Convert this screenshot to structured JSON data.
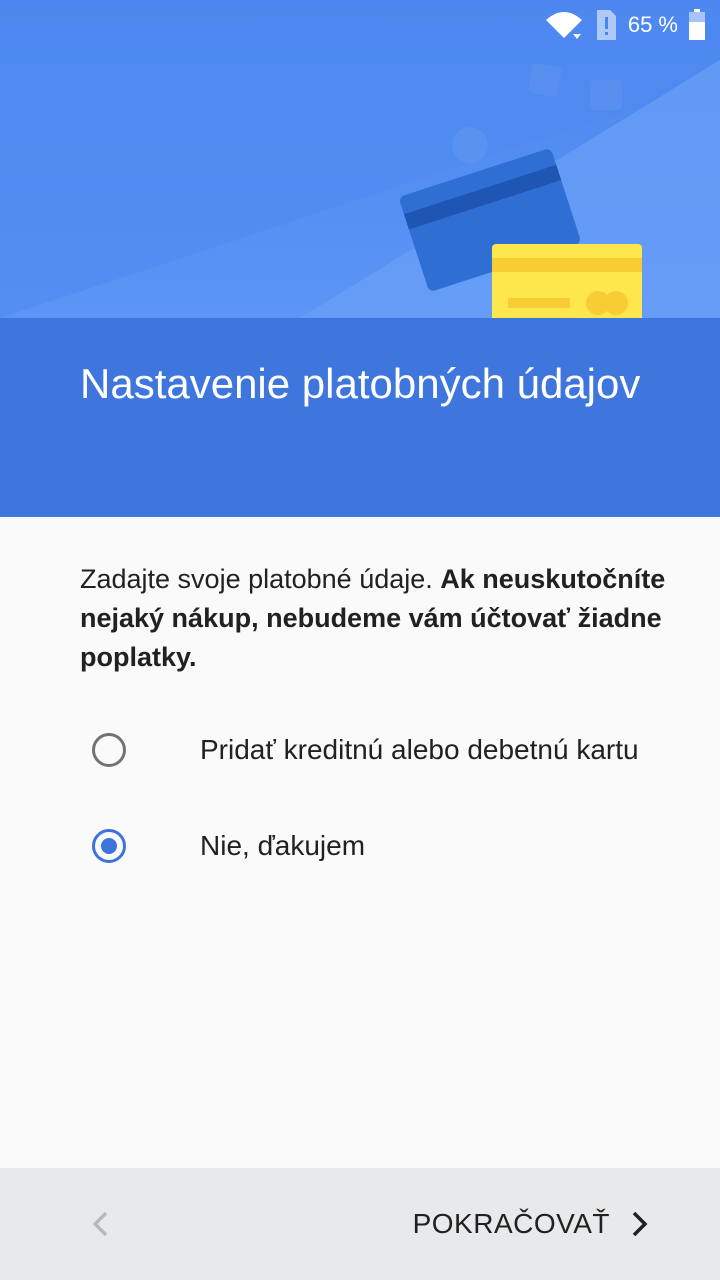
{
  "status_bar": {
    "battery_percent": "65 %",
    "icons": [
      "wifi-icon",
      "sim-alert-icon",
      "battery-icon"
    ]
  },
  "header": {
    "title": "Nastavenie platobných údajov",
    "illustration": "payment-cards-illustration"
  },
  "intro": {
    "text": "Zadajte svoje platobné údaje. ",
    "bold_text": "Ak neuskutočníte nejaký nákup, nebudeme vám účtovať žiadne poplatky."
  },
  "options": [
    {
      "label": "Pridať kreditnú alebo debetnú kartu",
      "selected": false
    },
    {
      "label": "Nie, ďakujem",
      "selected": true
    }
  ],
  "footer": {
    "back_icon": "chevron-left-icon",
    "next_label": "POKRAČOVAŤ",
    "next_icon": "chevron-right-icon"
  },
  "colors": {
    "accent": "#3c73dc",
    "header_band": "#3f76de",
    "card_yellow": "#fde74c"
  }
}
